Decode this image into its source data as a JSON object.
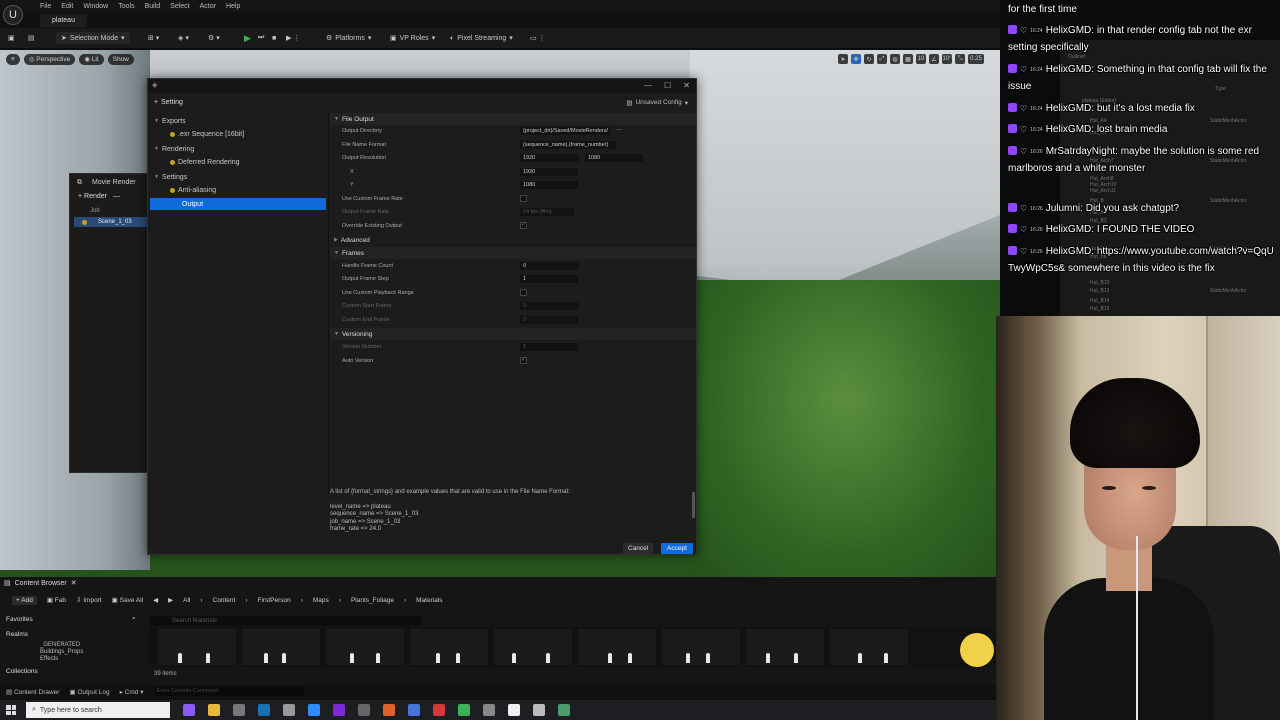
{
  "menubar": {
    "items": [
      "File",
      "Edit",
      "Window",
      "Tools",
      "Build",
      "Select",
      "Actor",
      "Help"
    ]
  },
  "project_tab": "plateau",
  "toolbar": {
    "selection_mode": "Selection Mode",
    "platforms": "Platforms",
    "vp_roles": "VP Roles",
    "pixel_streaming": "Pixel Streaming"
  },
  "viewport": {
    "perspective": "Perspective",
    "lit": "Lit",
    "show": "Show",
    "grid_snap": "10",
    "angle_snap": "10°",
    "scale_snap": "0.25"
  },
  "render_queue": {
    "title": "Movie Render",
    "render_label": "Render",
    "job_header": "Job",
    "job_name": "Scene_1_03"
  },
  "dialog": {
    "setting_label": "Setting",
    "unsaved_label": "Unsaved Config",
    "tree": {
      "exports": "Exports",
      "exr": ".exr Sequence [16bit]",
      "rendering": "Rendering",
      "deferred": "Deferred Rendering",
      "settings": "Settings",
      "antialiasing": "Anti-aliasing",
      "output": "Output"
    },
    "sections": {
      "file_output": "File Output",
      "advanced": "Advanced",
      "frames": "Frames",
      "versioning": "Versioning"
    },
    "props": {
      "output_directory": "Output Directory",
      "output_directory_value": "{project_dir}/Saved/MovieRenders/",
      "file_name_format": "File Name Format",
      "file_name_format_value": "{sequence_name}.{frame_number}",
      "output_resolution": "Output Resolution",
      "res_w": "1920",
      "res_h": "1080",
      "x_label": "X",
      "y_label": "Y",
      "x_value": "1920",
      "y_value": "1080",
      "use_custom_frame_rate": "Use Custom Frame Rate",
      "output_frame_rate": "Output Frame Rate",
      "output_frame_rate_value": "24 fps (film)",
      "override_existing": "Override Existing Output",
      "handle_frame_count": "Handle Frame Count",
      "handle_frame_count_value": "0",
      "output_frame_step": "Output Frame Step",
      "output_frame_step_value": "1",
      "use_custom_playback": "Use Custom Playback Range",
      "custom_start": "Custom Start Frame",
      "custom_start_value": "0",
      "custom_end": "Custom End Frame",
      "custom_end_value": "0",
      "version_number": "Version Number",
      "version_number_value": "1",
      "auto_version": "Auto Version"
    },
    "help": {
      "line1": "A list of {format_strings} and example values that are valid to use in the File Name Format:",
      "line2": "level_name => plateau",
      "line3": "sequence_name => Scene_1_03",
      "line4": "job_name => Scene_1_03",
      "line5": "frame_rate => 24.0"
    },
    "cancel": "Cancel",
    "accept": "Accept"
  },
  "content_browser": {
    "tab": "Content Browser",
    "add": "Add",
    "fab": "Fab",
    "import": "Import",
    "save_all": "Save All",
    "breadcrumbs": [
      "All",
      "Content",
      "FirstPerson",
      "Maps",
      "Plants_Foliage",
      "Materials"
    ],
    "favorites": "Favorites",
    "realms": "Realms",
    "folders": [
      "_GENERATED",
      "Buildings_Props",
      "Effects"
    ],
    "collections": "Collections",
    "search_placeholder": "Search Materials",
    "item_count": "39 items",
    "bottom": {
      "drawer": "Content Drawer",
      "output_log": "Output Log",
      "cmd": "Cmd",
      "console_placeholder": "Enter Console Command"
    }
  },
  "taskbar": {
    "search_placeholder": "Type here to search"
  },
  "outliner": {
    "title": "Outliner",
    "type_col": "Type",
    "rows": [
      "plateau (Editor)",
      "Hut_A4",
      "Hut_A6",
      "Hut_Arch7",
      "Hut_Arch8",
      "Hut_Arch10",
      "Hut_Arch11",
      "Hut_B",
      "Hut_B2",
      "Hut_B3",
      "Hut_B6",
      "Hut_B8",
      "Hut_B10",
      "Hut_B13",
      "Hut_B14",
      "Hut_B15"
    ],
    "type_value": "StaticMeshActor"
  },
  "chat": {
    "lines": [
      {
        "time": "",
        "text": "for the first time",
        "continuation": true
      },
      {
        "time": "16:24",
        "user": "HelixGMD",
        "text": "in that render config tab not the exr setting specifically"
      },
      {
        "time": "16:24",
        "user": "HelixGMD",
        "text": "Something in that config tab will fix the issue"
      },
      {
        "time": "16:24",
        "user": "HelixGMD",
        "text": "but it's a lost media fix"
      },
      {
        "time": "16:24",
        "user": "HelixGMD",
        "text": "lost brain media"
      },
      {
        "time": "16:26",
        "user": "MrSatrdayNight",
        "text": "maybe the solution is some red marlboros and a white monster"
      },
      {
        "time": "16:26",
        "user": "Julumni",
        "text": "Did you ask chatgpt?"
      },
      {
        "time": "16:26",
        "user": "HelixGMD",
        "text": "I FOUND THE VIDEO"
      },
      {
        "time": "16:26",
        "user": "HelixGMD",
        "text": "https://www.youtube.com/watch?v=QqUTwyWpC5s& somewhere in this video is the fix"
      }
    ]
  }
}
